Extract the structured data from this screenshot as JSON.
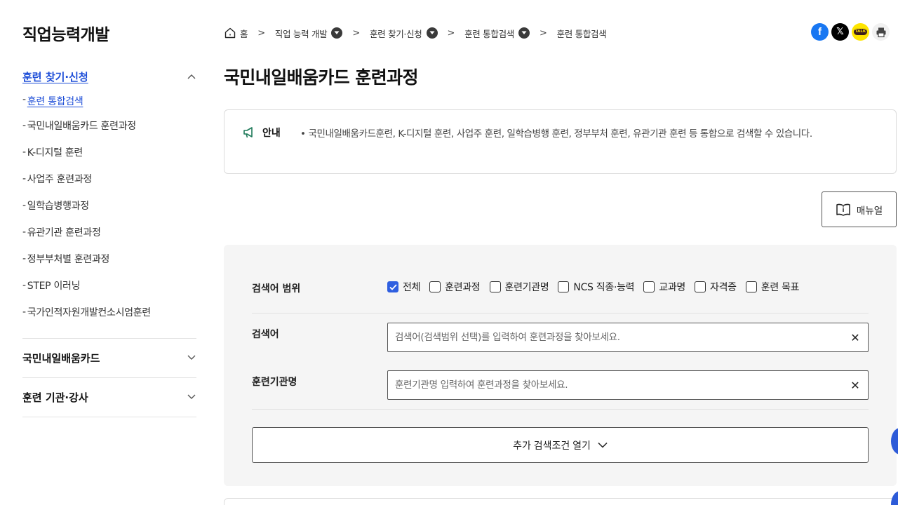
{
  "sidebar": {
    "title": "직업능력개발",
    "open_section": {
      "label": "훈련 찾기·신청",
      "items": [
        {
          "label": "훈련 통합검색",
          "active": true
        },
        {
          "label": "국민내일배움카드 훈련과정"
        },
        {
          "label": "K-디지털 훈련"
        },
        {
          "label": "사업주 훈련과정"
        },
        {
          "label": "일학습병행과정"
        },
        {
          "label": "유관기관 훈련과정"
        },
        {
          "label": "정부부처별 훈련과정"
        },
        {
          "label": "STEP 이러닝"
        },
        {
          "label": "국가인적자원개발컨소시엄훈련"
        }
      ]
    },
    "closed_sections": [
      {
        "label": "국민내일배움카드"
      },
      {
        "label": "훈련 기관·강사"
      }
    ]
  },
  "breadcrumb": {
    "home": "홈",
    "items": [
      "직업 능력 개발",
      "훈련 찾기·신청",
      "훈련 통합검색",
      "훈련 통합검색"
    ]
  },
  "share": {
    "icons": [
      "facebook-icon",
      "x-icon",
      "kakaotalk-icon",
      "print-icon"
    ],
    "facebook_letter": "f",
    "x_letter": "𝕏",
    "kakao_text": "TALK"
  },
  "page": {
    "title": "국민내일배움카드 훈련과정"
  },
  "notice": {
    "label": "안내",
    "text": "• 국민내일배움카드훈련, K-디지털 훈련, 사업주 훈련, 일학습병행 훈련, 정부부처 훈련, 유관기관 훈련 등 통합으로 검색할 수 있습니다."
  },
  "manual_button": {
    "label": "매뉴얼"
  },
  "search": {
    "scope_label": "검색어 범위",
    "scopes": [
      {
        "label": "전체",
        "checked": true
      },
      {
        "label": "훈련과정",
        "checked": false
      },
      {
        "label": "훈련기관명",
        "checked": false
      },
      {
        "label": "NCS 직종·능력",
        "checked": false
      },
      {
        "label": "교과명",
        "checked": false
      },
      {
        "label": "자격증",
        "checked": false
      },
      {
        "label": "훈련 목표",
        "checked": false
      }
    ],
    "keyword_label": "검색어",
    "keyword_value": "",
    "keyword_placeholder": "검색어(검색범위 선택)를 입력하여 훈련과정을 찾아보세요.",
    "institution_label": "훈련기관명",
    "institution_value": "",
    "institution_placeholder": "훈련기관명 입력하여 훈련과정을 찾아보세요.",
    "more_label": "추가 검색조건 열기"
  },
  "colors": {
    "accent": "#1f4fd8",
    "checkbox_checked": "#2f5fe0",
    "facebook": "#1877f2",
    "x": "#000000",
    "kakao": "#fee500",
    "panel_bg": "#f5f5f5"
  }
}
